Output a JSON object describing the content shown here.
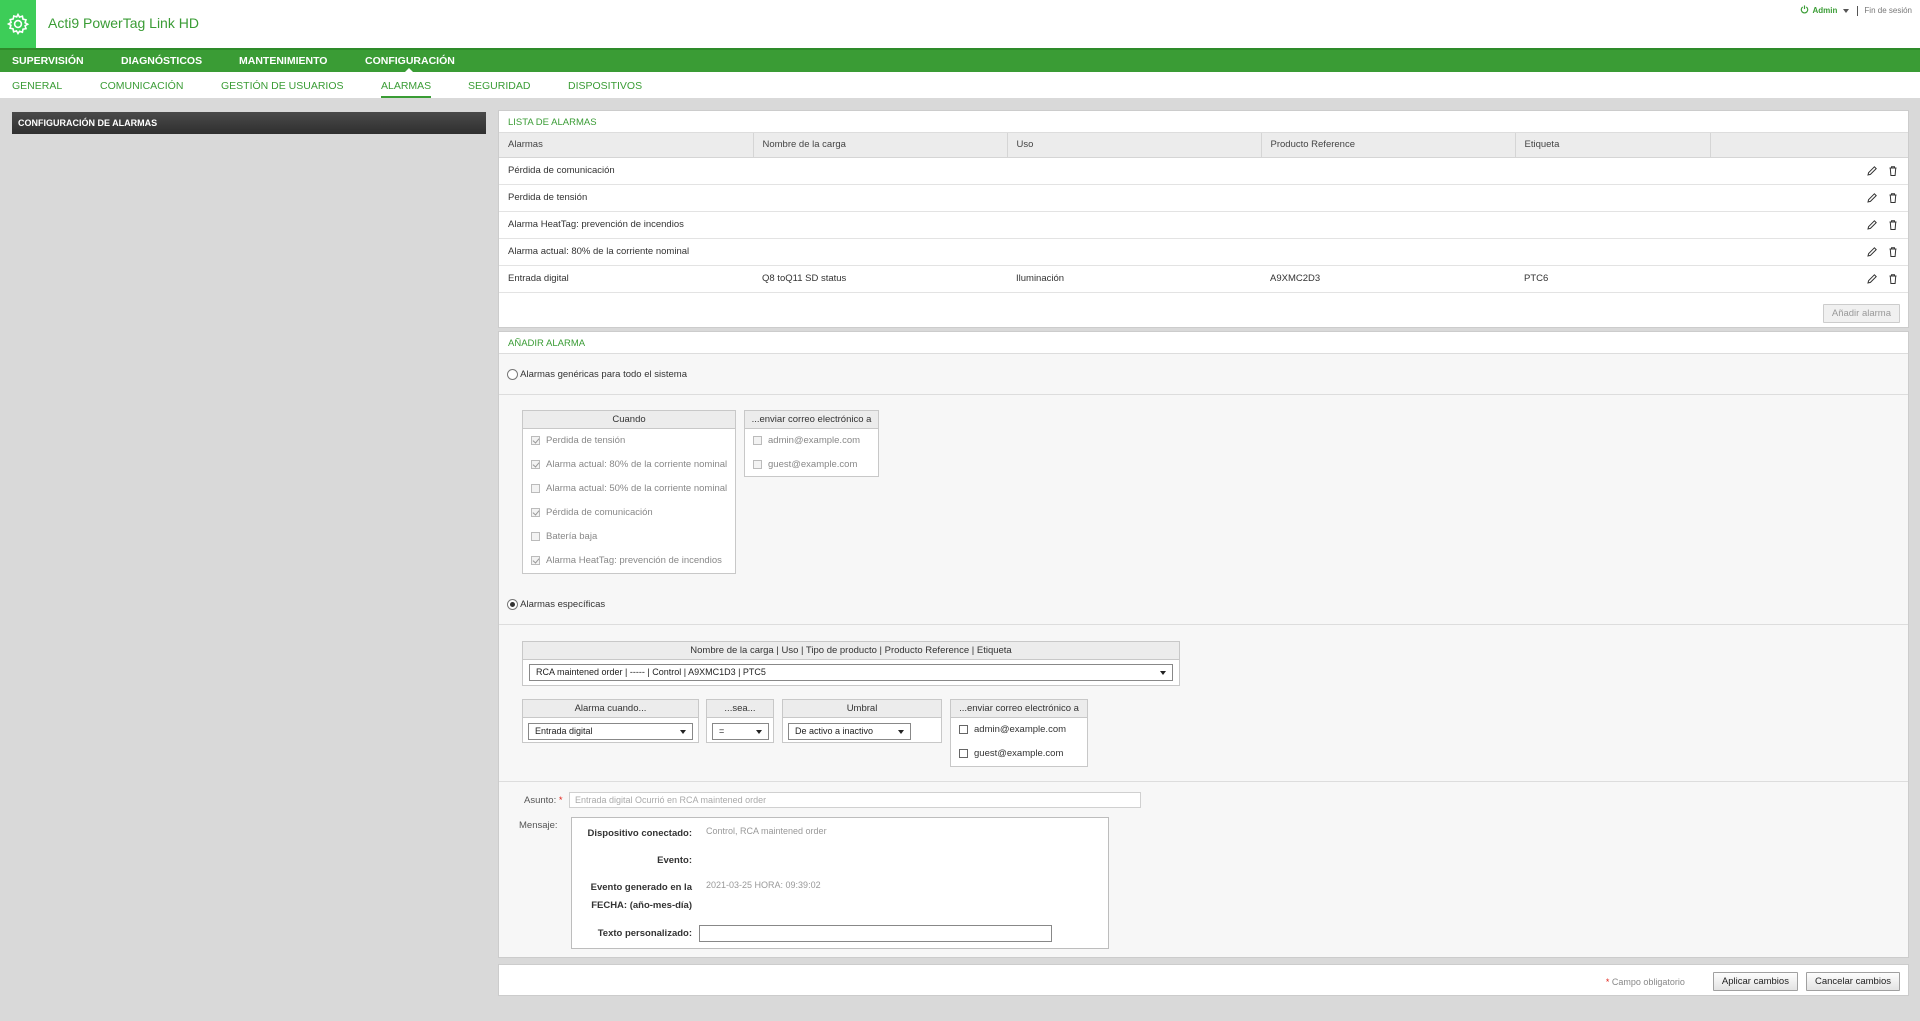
{
  "header": {
    "app_title": "Acti9 PowerTag Link HD",
    "user_name": "Admin",
    "logout": "Fin de sesión"
  },
  "main_nav": [
    "SUPERVISIÓN",
    "DIAGNÓSTICOS",
    "MANTENIMIENTO",
    "CONFIGURACIÓN"
  ],
  "sub_nav": [
    "GENERAL",
    "COMUNICACIÓN",
    "GESTIÓN DE USUARIOS",
    "ALARMAS",
    "SEGURIDAD",
    "DISPOSITIVOS"
  ],
  "sidebar": {
    "title": "CONFIGURACIÓN DE ALARMAS"
  },
  "alarm_list": {
    "title": "LISTA DE ALARMAS",
    "columns": [
      "Alarmas",
      "Nombre de la carga",
      "Uso",
      "Producto Reference",
      "Etiqueta"
    ],
    "rows": [
      [
        "Pérdida de comunicación",
        "",
        "",
        "",
        ""
      ],
      [
        "Perdida de tensión",
        "",
        "",
        "",
        ""
      ],
      [
        "Alarma HeatTag: prevención de incendios",
        "",
        "",
        "",
        ""
      ],
      [
        "Alarma actual: 80% de la corriente nominal",
        "",
        "",
        "",
        ""
      ],
      [
        "Entrada digital",
        "Q8 toQ11 SD status",
        "Iluminación",
        "A9XMC2D3",
        "PTC6"
      ]
    ],
    "add_button": "Añadir alarma"
  },
  "add_alarm": {
    "title": "AÑADIR ALARMA",
    "generic_label": "Alarmas genéricas para todo el sistema",
    "when_header": "Cuando",
    "when_items": [
      "Perdida de tensión",
      "Alarma actual: 80% de la corriente nominal",
      "Alarma actual: 50% de la corriente nominal",
      "Pérdida de comunicación",
      "Batería baja",
      "Alarma HeatTag: prevención de incendios"
    ],
    "email_header": "...enviar correo electrónico a",
    "emails": [
      "admin@example.com",
      "guest@example.com"
    ],
    "specific_label": "Alarmas específicas",
    "load_header": "Nombre de la carga | Uso | Tipo de producto | Producto Reference | Etiqueta",
    "load_value": "RCA maintened order | ----- | Control | A9XMC1D3 | PTC5",
    "alarm_when_header": "Alarma cuando...",
    "alarm_when_value": "Entrada digital",
    "is_header": "...sea...",
    "is_value": "=",
    "threshold_header": "Umbral",
    "threshold_value": "De activo a inactivo",
    "subject_label": "Asunto:",
    "required_mark": "*",
    "subject_value": "Entrada digital   Ocurrió en RCA maintened order",
    "message_label": "Mensaje:",
    "msg_device_label": "Dispositivo conectado:",
    "msg_device_value": "Control, RCA maintened order",
    "msg_event_label": "Evento:",
    "msg_date_label_1": "Evento generado en la",
    "msg_date_label_2": "FECHA: (año-mes-día)",
    "msg_date_value": "2021-03-25 HORA: 09:39:02",
    "msg_custom_label": "Texto personalizado:"
  },
  "footer": {
    "required_note": "Campo obligatorio",
    "apply": "Aplicar cambios",
    "cancel": "Cancelar cambios"
  },
  "colors": {
    "brand_green": "#3a9c35",
    "logo_green": "#3dcd58",
    "background": "#d9d9d9"
  }
}
